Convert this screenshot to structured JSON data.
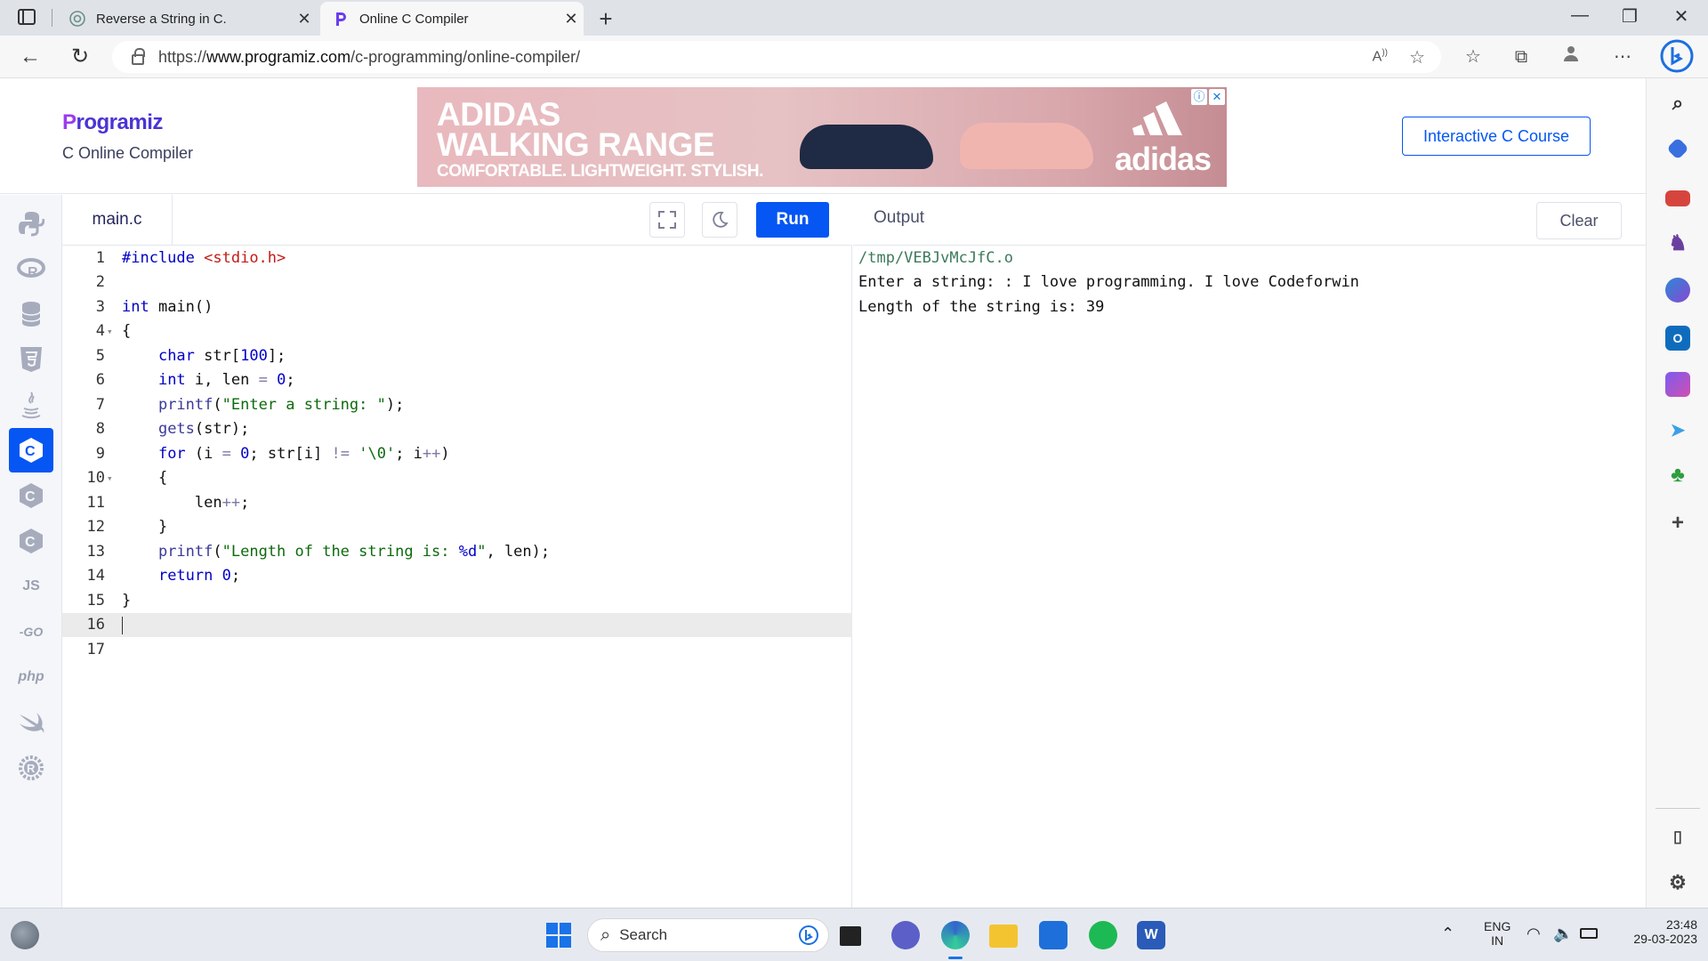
{
  "browser": {
    "tabs": [
      {
        "title": "Reverse a String in C.",
        "active": false,
        "icon": "chatgpt-icon"
      },
      {
        "title": "Online C Compiler",
        "active": true,
        "icon": "programiz-icon"
      }
    ],
    "url_prefix": "https://",
    "url_domain": "www.programiz.com",
    "url_path": "/c-programming/online-compiler/"
  },
  "header": {
    "logo": "Programiz",
    "subtitle": "C Online Compiler",
    "course_button": "Interactive C Course",
    "ad": {
      "line1": "ADIDAS",
      "line2": "WALKING RANGE",
      "line3": "COMFORTABLE. LIGHTWEIGHT. STYLISH.",
      "brand": "adidas"
    }
  },
  "languages": [
    "python-icon",
    "r-icon",
    "sql-icon",
    "html-icon",
    "java-icon",
    "c-icon",
    "cpp-icon",
    "csharp-icon",
    "js-icon",
    "go-icon",
    "php-icon",
    "swift-icon",
    "rust-icon"
  ],
  "lang_labels": {
    "js": "JS",
    "go": "-GO",
    "php": "php"
  },
  "editor": {
    "file_tab": "main.c",
    "run_label": "Run",
    "active_line": 16,
    "line_numbers": [
      "1",
      "2",
      "3",
      "4",
      "5",
      "6",
      "7",
      "8",
      "9",
      "10",
      "11",
      "12",
      "13",
      "14",
      "15",
      "16",
      "17"
    ]
  },
  "output": {
    "title": "Output",
    "clear_label": "Clear",
    "lines": [
      "/tmp/VEBJvMcJfC.o",
      "Enter a string: : I love programming. I love Codeforwin",
      "Length of the string is: 39"
    ]
  },
  "taskbar": {
    "search_placeholder": "Search",
    "lang_line1": "ENG",
    "lang_line2": "IN",
    "time": "23:48",
    "date": "29-03-2023"
  }
}
